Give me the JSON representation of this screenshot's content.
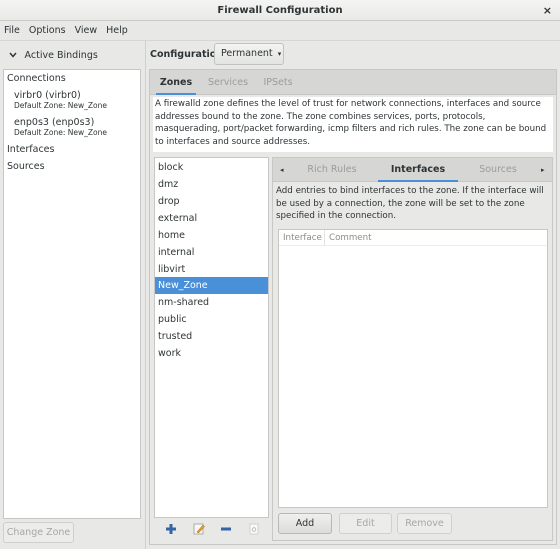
{
  "window": {
    "title": "Firewall Configuration",
    "close_glyph": "×"
  },
  "menu": [
    "File",
    "Options",
    "View",
    "Help"
  ],
  "active_bindings": {
    "header": "Active Bindings",
    "chevron_glyph": "⌄",
    "connections_label": "Connections",
    "connections": [
      {
        "name": "virbr0 (virbr0)",
        "zone": "Default Zone: New_Zone"
      },
      {
        "name": "enp0s3 (enp0s3)",
        "zone": "Default Zone: New_Zone"
      }
    ],
    "interfaces_label": "Interfaces",
    "sources_label": "Sources",
    "change_zone_button": "Change Zone"
  },
  "configuration": {
    "label": "Configuration:",
    "value": "Permanent",
    "arrow_glyph": "▾"
  },
  "main_tabs": [
    {
      "label": "Zones",
      "active": true
    },
    {
      "label": "Services",
      "active": false
    },
    {
      "label": "IPSets",
      "active": false
    }
  ],
  "zone_description": "A firewalld zone defines the level of trust for network connections, interfaces and source addresses bound to the zone. The zone combines services, ports, protocols, masquerading, port/packet forwarding, icmp filters and rich rules. The zone can be bound to interfaces and source addresses.",
  "zones": [
    "block",
    "dmz",
    "drop",
    "external",
    "home",
    "internal",
    "libvirt",
    "New_Zone",
    "nm-shared",
    "public",
    "trusted",
    "work"
  ],
  "selected_zone": "New_Zone",
  "zone_tools": [
    {
      "name": "add-zone",
      "glyph": "+"
    },
    {
      "name": "edit-zone",
      "glyph": "✎"
    },
    {
      "name": "remove-zone",
      "glyph": "−"
    },
    {
      "name": "load-defaults",
      "glyph": "↺"
    }
  ],
  "zone_tabs": {
    "left_arrow": "◂",
    "right_arrow": "▸",
    "tabs": [
      {
        "label": "Rich Rules",
        "active": false
      },
      {
        "label": "Interfaces",
        "active": true
      },
      {
        "label": "Sources",
        "active": false
      }
    ]
  },
  "interfaces": {
    "description": "Add entries to bind interfaces to the zone. If the interface will be used by a connection, the zone will be set to the zone specified in the connection.",
    "columns": [
      "Interface",
      "Comment"
    ],
    "rows": [],
    "buttons": {
      "add": "Add",
      "edit": "Edit",
      "remove": "Remove"
    }
  },
  "colors": {
    "accent": "#4a90d9",
    "selection_text": "#ffffff",
    "tool_blue": "#3465a4"
  }
}
